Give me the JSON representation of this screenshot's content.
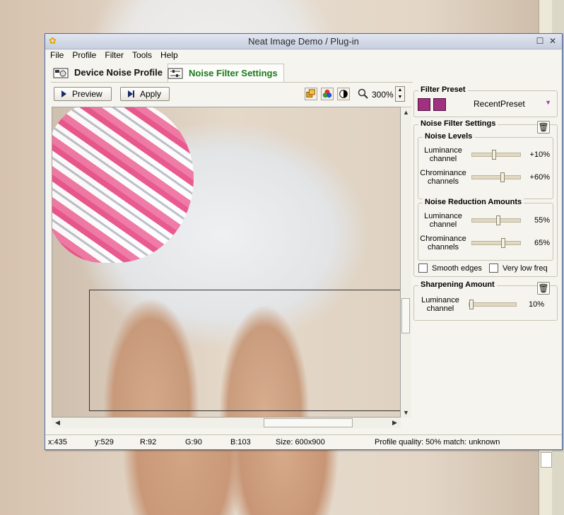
{
  "window": {
    "title": "Neat Image Demo / Plug-in"
  },
  "menu": [
    "File",
    "Profile",
    "Filter",
    "Tools",
    "Help"
  ],
  "tabs": {
    "device_profile": "Device Noise Profile",
    "filter_settings": "Noise Filter Settings"
  },
  "toolbar": {
    "preview_label": "Preview",
    "apply_label": "Apply",
    "zoom": "300%"
  },
  "filter_preset": {
    "title": "Filter Preset",
    "selected": "RecentPreset"
  },
  "noise_filter": {
    "title": "Noise Filter Settings",
    "levels": {
      "title": "Noise Levels",
      "luminance_label": "Luminance channel",
      "luminance_value": "+10%",
      "luminance_position": 0.45,
      "chrominance_label": "Chrominance channels",
      "chrominance_value": "+60%",
      "chrominance_position": 0.63
    },
    "reduction": {
      "title": "Noise Reduction Amounts",
      "luminance_label": "Luminance channel",
      "luminance_value": "55%",
      "luminance_position": 0.55,
      "chrominance_label": "Chrominance channels",
      "chrominance_value": "65%",
      "chrominance_position": 0.65
    },
    "smooth_edges": "Smooth edges",
    "very_low_freq": "Very low freq"
  },
  "sharpening": {
    "title": "Sharpening Amount",
    "luminance_label": "Luminance channel",
    "luminance_value": "10%",
    "luminance_position": 0.05
  },
  "status": {
    "x": "x:435",
    "y": "y:529",
    "r": "R:92",
    "g": "G:90",
    "b": "B:103",
    "size": "Size: 600x900",
    "quality": "Profile quality: 50%  match: unknown"
  }
}
